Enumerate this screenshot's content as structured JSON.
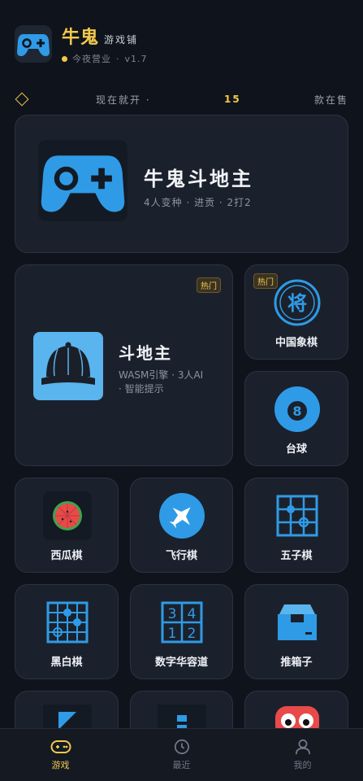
{
  "header": {
    "brand_name": "牛鬼",
    "brand_sub": "游戏铺",
    "status": "今夜营业",
    "version": "v1.7",
    "separator": "·"
  },
  "ticker": {
    "prefix": "现在就开 ·",
    "count": "15",
    "suffix": "款在售"
  },
  "featured": {
    "title": "牛鬼斗地主",
    "meta": "4人变种 · 进贡 · 2打2"
  },
  "doudizhu": {
    "title": "斗地主",
    "meta_line1": "WASM引擎 · 3人AI",
    "meta_line2": "· 智能提示",
    "badge": "热门"
  },
  "games": [
    {
      "label": "中国象棋",
      "badge": "热门",
      "icon": "chess-general-icon",
      "glyph": "将"
    },
    {
      "label": "台球",
      "icon": "billiard-8-ball-icon",
      "glyph": "8"
    },
    {
      "label": "西瓜棋",
      "icon": "watermelon-icon"
    },
    {
      "label": "飞行棋",
      "icon": "airplane-icon"
    },
    {
      "label": "五子棋",
      "icon": "gomoku-board-icon"
    },
    {
      "label": "黑白棋",
      "icon": "reversi-board-icon"
    },
    {
      "label": "数字华容道",
      "icon": "number-puzzle-icon",
      "digits": [
        "3",
        "4",
        "1",
        "2"
      ]
    },
    {
      "label": "推箱子",
      "icon": "sokoban-box-icon"
    }
  ],
  "nav": [
    {
      "label": "游戏",
      "icon": "gamepad-icon",
      "active": true
    },
    {
      "label": "最近",
      "icon": "clock-icon"
    },
    {
      "label": "我的",
      "icon": "user-icon"
    }
  ],
  "colors": {
    "accent": "#f2c94c",
    "blue": "#2f9be6",
    "card": "#1b212c",
    "background": "#0f131b"
  }
}
